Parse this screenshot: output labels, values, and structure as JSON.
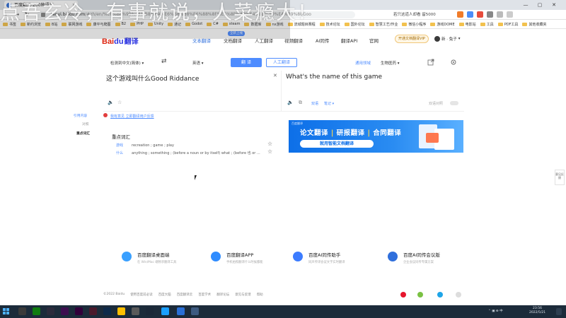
{
  "browser": {
    "active_tab": "百度翻译-200种语言...",
    "url_host": "fanyi.baidu.com",
    "url_rest": "/#zh/en/%E8%BF%99%E4%B8%AA%E6%B8%B8%E6%88%8F%E5%8F%AB%E4%BB%80%E4%B9%88Goo",
    "search_ext": "若只这道人却看 留5000",
    "bookmarks": [
      "书签",
      "新约浏览",
      "B站",
      "联网游戏",
      "康平与爬图",
      "B2",
      "PHP",
      "Unity",
      "通记",
      "Godot",
      "C#",
      "steam",
      "数据库",
      "nx游戏",
      "流城题目赛程",
      "技术论坛",
      "国外论坛",
      "智慧工艺/作业",
      "微信小程序",
      "游戏DOME",
      "电影站",
      "工具",
      "PDF工具",
      "其他收藏夹"
    ]
  },
  "overlay": {
    "text": "点吾玄冷，有事就说，人菜瘾大！"
  },
  "nav": {
    "logo_bai": "Bai",
    "logo_du": "du",
    "logo_fy": "翻译",
    "items": [
      "文本翻译",
      "文档翻译",
      "人工翻译",
      "视频翻译",
      "AI同传",
      "翻译API",
      "官网"
    ],
    "hot_badge": "全新上线",
    "vip_label": "开通文档翻译VIP",
    "user_name": "新 · 兔子"
  },
  "translator": {
    "source_lang": "检测到中文(简体)",
    "target_lang": "英语",
    "translate_btn": "翻 译",
    "human_btn": "人工翻译",
    "domain_label": "通用领域",
    "domain_value": "生物医药",
    "source_text": "这个游戏叫什么Good Riddance",
    "target_text": "What's the name of this game",
    "target_link1": "双语",
    "target_link2": "笔记",
    "target_right": "双语对照",
    "feedback": "我有意见 立即翻译用户反馈",
    "side_nav": [
      "引用内容",
      "对照",
      "重点词汇"
    ],
    "keywords_title": "重点词汇",
    "keywords": [
      {
        "word": "游戏",
        "meaning": "recreation ; game ; play"
      },
      {
        "word": "什么",
        "meaning": "anything ; something ; (before a noun or by itself) what ; (before 也 or ..."
      }
    ]
  },
  "banner": {
    "brand": "百度翻译",
    "head1": "论文翻译",
    "sep": "|",
    "head2": "研报翻译",
    "head3": "合同翻译",
    "sub": "就用智能文档翻译"
  },
  "side_float": "意见反馈",
  "products": [
    {
      "title": "百度翻译桌面端",
      "sub": "在 Win/Mac 端畅享翻译工具",
      "color": "#3aa0ff"
    },
    {
      "title": "百度翻译APP",
      "sub": "手机拍照翻译什么时候都能",
      "color": "#2f8cff"
    },
    {
      "title": "百度AI同传助手",
      "sub": "同声传译会议文字实时翻译",
      "color": "#3c7cff"
    },
    {
      "title": "百度AI同传会议版",
      "sub": "企业会议同传专属方案",
      "color": "#2f6fdc"
    }
  ],
  "footer": [
    "©2022 Baidu",
    "使用百度前必读",
    "百度大脑",
    "百度翻译云",
    "百度学术",
    "翻译论坛",
    "意见与反馈",
    "帮助"
  ],
  "taskbar": {
    "time": "23:56",
    "date": "2022/5/21"
  }
}
